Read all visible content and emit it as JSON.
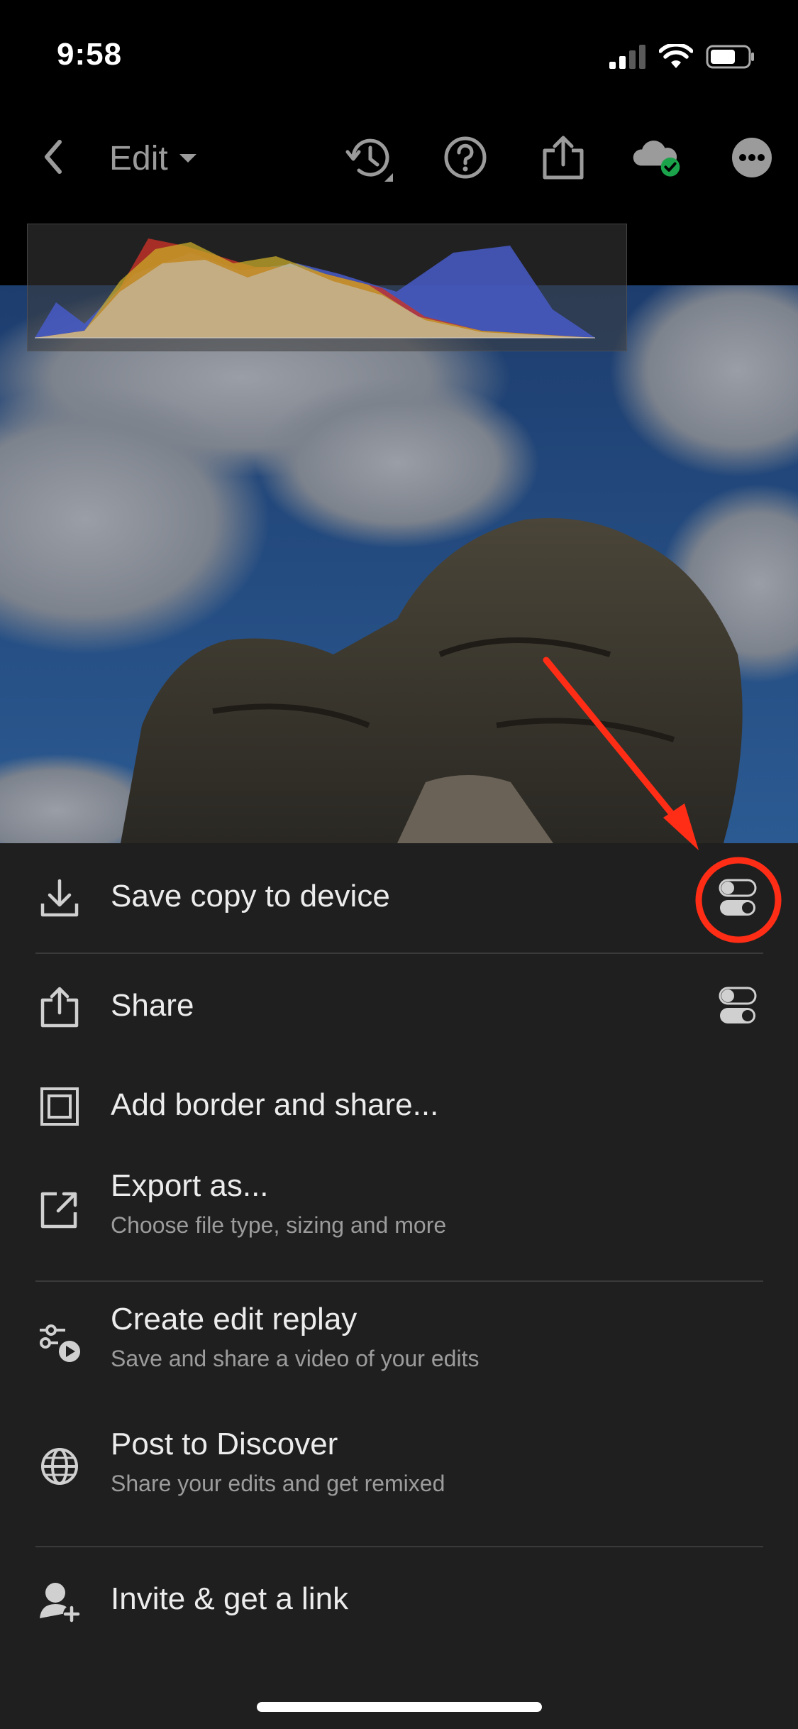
{
  "status": {
    "time": "9:58"
  },
  "topbar": {
    "edit_label": "Edit"
  },
  "menu": {
    "items": [
      {
        "title": "Save copy to device",
        "subtitle": ""
      },
      {
        "title": "Share",
        "subtitle": ""
      },
      {
        "title": "Add border and share...",
        "subtitle": ""
      },
      {
        "title": "Export as...",
        "subtitle": "Choose file type, sizing and more"
      },
      {
        "title": "Create edit replay",
        "subtitle": "Save and share a video of your edits"
      },
      {
        "title": "Post to Discover",
        "subtitle": "Share your edits and get remixed"
      },
      {
        "title": "Invite & get a link",
        "subtitle": ""
      }
    ]
  },
  "icons": {
    "status": [
      "cellular-signal-icon",
      "wifi-icon",
      "battery-icon"
    ],
    "topbar": [
      "back-chevron-icon",
      "dropdown-caret-icon",
      "history-icon",
      "help-icon",
      "share-upload-icon",
      "cloud-synced-icon",
      "more-icon"
    ],
    "menu": [
      "download-icon",
      "share-icon",
      "border-icon",
      "export-icon",
      "edit-replay-icon",
      "globe-icon",
      "invite-user-icon"
    ],
    "options": [
      "options-toggle-icon",
      "options-toggle-icon"
    ]
  },
  "colors": {
    "background": "#000000",
    "sheet": "#1f1f1f",
    "annotation": "#ff2d16",
    "cloud_check": "#1aa34a"
  }
}
